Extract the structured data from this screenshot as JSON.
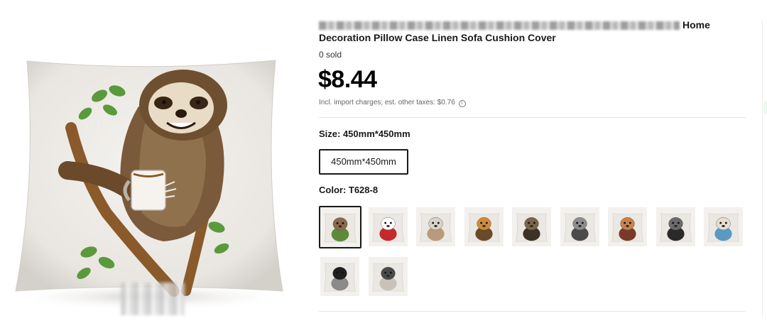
{
  "product": {
    "title_line1_suffix": "Home",
    "title_line2": "Decoration Pillow Case Linen Sofa Cushion Cover",
    "sold": "0 sold",
    "price": "$8.44",
    "tax_note": "Incl. import charges; est. other taxes: $0.76",
    "tax_icon": "info-icon"
  },
  "size": {
    "label": "Size: 450mm*450mm",
    "options": [
      "450mm*450mm"
    ],
    "selected": "450mm*450mm"
  },
  "color": {
    "label": "Color: T628-8",
    "selected_index": 0,
    "swatches": [
      {
        "animal": "sloth",
        "fur": "#8a6a4a",
        "accent": "#5c8a3a"
      },
      {
        "animal": "santa-dog",
        "fur": "#ffffff",
        "accent": "#c42a2a"
      },
      {
        "animal": "hedgehog",
        "fur": "#d9d2c8",
        "accent": "#b79b7a"
      },
      {
        "animal": "cat",
        "fur": "#d08a3a",
        "accent": "#6b4a2a"
      },
      {
        "animal": "owl",
        "fur": "#7a6548",
        "accent": "#3d3024"
      },
      {
        "animal": "wolf",
        "fur": "#8d8d8d",
        "accent": "#4a4a4a"
      },
      {
        "animal": "bulldog",
        "fur": "#c8824a",
        "accent": "#7a3a2a"
      },
      {
        "animal": "raccoon",
        "fur": "#6a6a6a",
        "accent": "#2a2a2a"
      },
      {
        "animal": "llama",
        "fur": "#e6ddd0",
        "accent": "#5a9ac2"
      },
      {
        "animal": "black-cat",
        "fur": "#1f1f1f",
        "accent": "#8a8a8a"
      },
      {
        "animal": "tabby-cat",
        "fur": "#4a4a4a",
        "accent": "#c9c2b8"
      }
    ]
  }
}
